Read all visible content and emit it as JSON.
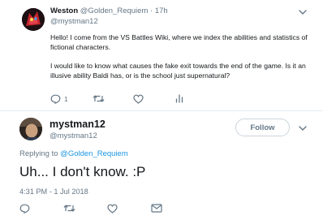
{
  "reply_tweet": {
    "author_name": "Weston",
    "author_handle": "@Golden_Requiem",
    "separator": "·",
    "time": "17h",
    "replying_to": "@mystman12",
    "paragraph_1": "Hello! I come from the VS Battles Wiki, where we index the abilities and statistics of fictional characters.",
    "paragraph_2": "I would like to know what causes the fake exit towards the end of the game. Is it an illusive ability Baldi has, or is the school just supernatural?",
    "reply_count": "1",
    "icons": [
      "reply-icon",
      "retweet-icon",
      "like-icon",
      "analytics-icon",
      "chevron-down-icon"
    ]
  },
  "main_tweet": {
    "author_name": "mystman12",
    "author_handle": "@mystman12",
    "follow_label": "Follow",
    "replying_prefix": "Replying to",
    "replying_link": "@Golden_Requiem",
    "text": "Uh... I don't know. :P",
    "timestamp": "4:31 PM - 1 Jul 2018",
    "icons": [
      "reply-icon",
      "retweet-icon",
      "like-icon",
      "message-icon",
      "chevron-down-icon"
    ]
  },
  "colors": {
    "accent": "#1b95e0",
    "muted": "#657786",
    "text": "#14171a",
    "border": "#e6ecf0"
  }
}
